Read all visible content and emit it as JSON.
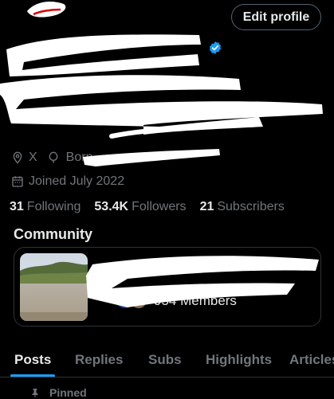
{
  "profile": {
    "edit_button": "Edit profile",
    "location": "X",
    "born_prefix": "Born",
    "joined": "Joined July 2022"
  },
  "stats": {
    "following_count": "31",
    "following_label": "Following",
    "followers_count": "53.4K",
    "followers_label": "Followers",
    "subscribers_count": "21",
    "subscribers_label": "Subscribers"
  },
  "community": {
    "heading": "Community",
    "members": "954 Members"
  },
  "tabs": [
    {
      "label": "Posts",
      "active": true
    },
    {
      "label": "Replies"
    },
    {
      "label": "Subs"
    },
    {
      "label": "Highlights"
    },
    {
      "label": "Articles"
    }
  ],
  "pinned_label": "Pinned",
  "colors": {
    "accent": "#1d9bf0",
    "muted_text": "#71767b",
    "text": "#e7e9ea",
    "border": "#2f3336"
  }
}
